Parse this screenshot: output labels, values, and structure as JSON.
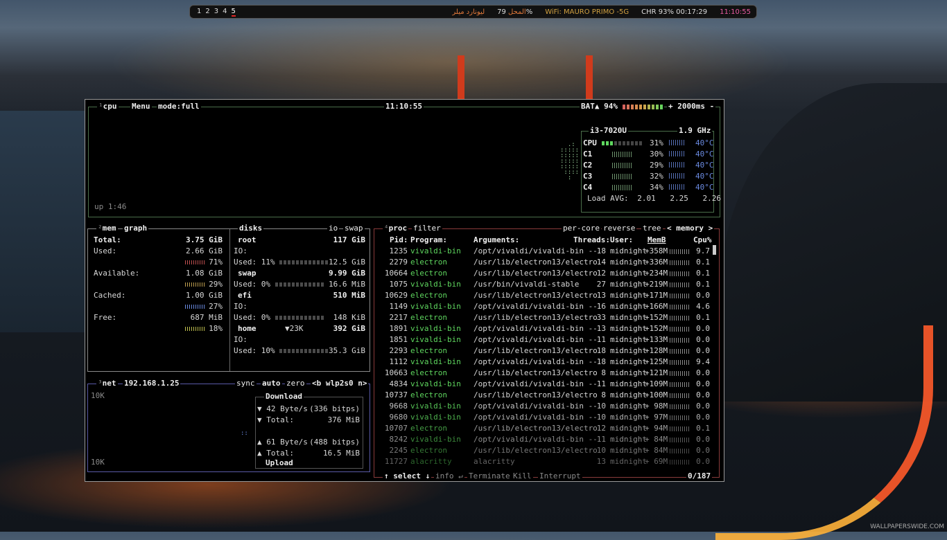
{
  "topbar": {
    "workspaces": [
      "1",
      "2",
      "3",
      "4",
      "5"
    ],
    "active_workspace": "5",
    "locale_text": "لیونارد میلر",
    "title_label": "المحل",
    "cpu_pct": "79%",
    "wifi": "WiFi: MAURO PRIMO -5G",
    "battery": "CHR 93% 00:17:29",
    "clock": "11:10:55"
  },
  "cpu_panel": {
    "num": "¹",
    "title": "cpu",
    "menu": "Menu",
    "mode": "mode:full",
    "time": "11:10:55",
    "battery": "BAT▲ 94%",
    "battery_fraction": 0.94,
    "plus": "+",
    "interval": "2000ms",
    "minus": "-",
    "uptime": "up 1:46",
    "model": "i3-7020U",
    "freq": "1.9 GHz",
    "cores": [
      {
        "label": "CPU",
        "pct": "31%",
        "temp": "40°C"
      },
      {
        "label": "C1",
        "pct": "30%",
        "temp": "40°C"
      },
      {
        "label": "C2",
        "pct": "29%",
        "temp": "40°C"
      },
      {
        "label": "C3",
        "pct": "32%",
        "temp": "40°C"
      },
      {
        "label": "C4",
        "pct": "34%",
        "temp": "40°C"
      }
    ],
    "load_label": "Load AVG:",
    "load": [
      "2.01",
      "2.25",
      "2.26"
    ]
  },
  "mem_panel": {
    "num": "²",
    "title": "mem",
    "graph": "graph",
    "total_label": "Total:",
    "total": "3.75 GiB",
    "rows": [
      {
        "label": "Used:",
        "value": "2.66 GiB",
        "pct": "71%"
      },
      {
        "label": "Available:",
        "value": "1.08 GiB",
        "pct": "29%"
      },
      {
        "label": "Cached:",
        "value": "1.00 GiB",
        "pct": "27%"
      },
      {
        "label": "Free:",
        "value": "687 MiB",
        "pct": "18%"
      }
    ]
  },
  "disks_panel": {
    "title": "disks",
    "io": "io",
    "swap": "swap",
    "disks": [
      {
        "name": "root",
        "size": "117 GiB",
        "io": "IO:",
        "used": "Used: 11%",
        "free": "12.5 GiB",
        "extra": ""
      },
      {
        "name": "swap",
        "size": "9.99 GiB",
        "io": "",
        "used": "Used:  0%",
        "free": "16.6 MiB",
        "extra": ""
      },
      {
        "name": "efi",
        "size": "510 MiB",
        "io": "IO:",
        "used": "Used:  0%",
        "free": "148 KiB",
        "extra": ""
      },
      {
        "name": "home",
        "size": "392 GiB",
        "io": "IO:",
        "used": "Used: 10%",
        "free": "35.3 GiB",
        "extra": "▼23K"
      }
    ]
  },
  "net_panel": {
    "num": "³",
    "title": "net",
    "ip": "192.168.1.25",
    "sync": "sync",
    "auto": "auto",
    "zero": "zero",
    "iface": "<b wlp2s0 n>",
    "scale_top": "10K",
    "scale_bottom": "10K",
    "download_label": "Download",
    "dl_rate": "▼ 42 Byte/s",
    "dl_bits": "(336 bitps)",
    "dl_total_label": "▼ Total:",
    "dl_total": "376 MiB",
    "ul_rate": "▲ 61 Byte/s",
    "ul_bits": "(488 bitps)",
    "ul_total_label": "▲ Total:",
    "ul_total": "16.5 MiB",
    "upload_label": "Upload"
  },
  "proc_panel": {
    "num": "⁴",
    "title": "proc",
    "filter": "filter",
    "per_core": "per-core",
    "reverse": "reverse",
    "tree": "tree",
    "sort": "< memory >",
    "headers": {
      "pid": "Pid:",
      "program": "Program:",
      "args": "Arguments:",
      "threads": "Threads:",
      "user": "User:",
      "mem": "MemB",
      "cpu": "Cpu%"
    },
    "rows": [
      {
        "pid": "1235",
        "program": "vivaldi-bin",
        "args": "/opt/vivaldi/vivaldi-bin --",
        "threads": "18",
        "user": "midnight",
        "mem": "+358M",
        "cpu": "9.7"
      },
      {
        "pid": "2279",
        "program": "electron",
        "args": "/usr/lib/electron13/electro",
        "threads": "14",
        "user": "midnight",
        "mem": "+336M",
        "cpu": "0.1"
      },
      {
        "pid": "10664",
        "program": "electron",
        "args": "/usr/lib/electron13/electro",
        "threads": "12",
        "user": "midnight",
        "mem": "+234M",
        "cpu": "0.1"
      },
      {
        "pid": "1075",
        "program": "vivaldi-bin",
        "args": "/usr/bin/vivaldi-stable",
        "threads": "27",
        "user": "midnight",
        "mem": "+219M",
        "cpu": "0.1"
      },
      {
        "pid": "10629",
        "program": "electron",
        "args": "/usr/lib/electron13/electro",
        "threads": "13",
        "user": "midnight",
        "mem": "+171M",
        "cpu": "0.0"
      },
      {
        "pid": "1149",
        "program": "vivaldi-bin",
        "args": "/opt/vivaldi/vivaldi-bin --",
        "threads": "16",
        "user": "midnight",
        "mem": "+166M",
        "cpu": "4.6"
      },
      {
        "pid": "2217",
        "program": "electron",
        "args": "/usr/lib/electron13/electro",
        "threads": "33",
        "user": "midnight",
        "mem": "+152M",
        "cpu": "0.1"
      },
      {
        "pid": "1891",
        "program": "vivaldi-bin",
        "args": "/opt/vivaldi/vivaldi-bin --",
        "threads": "13",
        "user": "midnight",
        "mem": "+152M",
        "cpu": "0.0"
      },
      {
        "pid": "1851",
        "program": "vivaldi-bin",
        "args": "/opt/vivaldi/vivaldi-bin --",
        "threads": "11",
        "user": "midnight",
        "mem": "+133M",
        "cpu": "0.0"
      },
      {
        "pid": "2293",
        "program": "electron",
        "args": "/usr/lib/electron13/electro",
        "threads": "18",
        "user": "midnight",
        "mem": "+128M",
        "cpu": "0.0"
      },
      {
        "pid": "1112",
        "program": "vivaldi-bin",
        "args": "/opt/vivaldi/vivaldi-bin --",
        "threads": "18",
        "user": "midnight",
        "mem": "+125M",
        "cpu": "9.4"
      },
      {
        "pid": "10663",
        "program": "electron",
        "args": "/usr/lib/electron13/electro",
        "threads": "8",
        "user": "midnight",
        "mem": "+121M",
        "cpu": "0.0"
      },
      {
        "pid": "4834",
        "program": "vivaldi-bin",
        "args": "/opt/vivaldi/vivaldi-bin --",
        "threads": "11",
        "user": "midnight",
        "mem": "+109M",
        "cpu": "0.0"
      },
      {
        "pid": "10737",
        "program": "electron",
        "args": "/usr/lib/electron13/electro",
        "threads": "8",
        "user": "midnight",
        "mem": "+100M",
        "cpu": "0.0"
      },
      {
        "pid": "9668",
        "program": "vivaldi-bin",
        "args": "/opt/vivaldi/vivaldi-bin --",
        "threads": "10",
        "user": "midnight",
        "mem": "+ 98M",
        "cpu": "0.0"
      },
      {
        "pid": "9680",
        "program": "vivaldi-bin",
        "args": "/opt/vivaldi/vivaldi-bin --",
        "threads": "10",
        "user": "midnight",
        "mem": "+ 97M",
        "cpu": "0.0"
      },
      {
        "pid": "10707",
        "program": "electron",
        "args": "/usr/lib/electron13/electro",
        "threads": "12",
        "user": "midnight",
        "mem": "+ 94M",
        "cpu": "0.1"
      },
      {
        "pid": "8242",
        "program": "vivaldi-bin",
        "args": "/opt/vivaldi/vivaldi-bin --",
        "threads": "11",
        "user": "midnight",
        "mem": "+ 84M",
        "cpu": "0.0"
      },
      {
        "pid": "2245",
        "program": "electron",
        "args": "/usr/lib/electron13/electro",
        "threads": "10",
        "user": "midnight",
        "mem": "+ 84M",
        "cpu": "0.0"
      },
      {
        "pid": "11727",
        "program": "alacritty",
        "args": "alacritty",
        "threads": "13",
        "user": "midnight",
        "mem": "+ 69M",
        "cpu": "0.0"
      }
    ],
    "footer": {
      "select": "↑ select ↓",
      "info": "info ↵",
      "terminate": "Terminate",
      "kill": "Kill",
      "interrupt": "Interrupt",
      "count": "0/187"
    }
  },
  "wallpaper_mark": "WALLPAPERSWIDE.COM",
  "colors": {
    "accent_green": "#5fd75f",
    "accent_red": "#d65f5f",
    "temp_blue": "#6a8ae0"
  }
}
